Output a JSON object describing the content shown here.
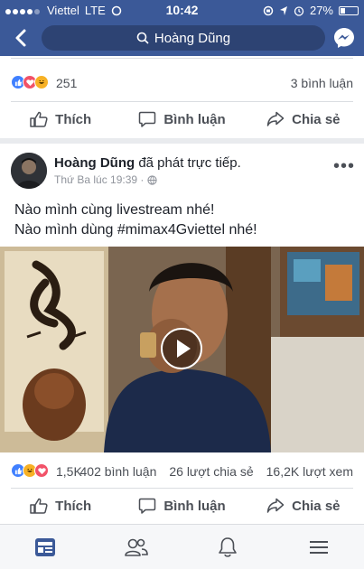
{
  "status_bar": {
    "carrier": "Viettel",
    "network": "LTE",
    "time": "10:42",
    "battery": "27%",
    "battery_level": 0.27
  },
  "nav": {
    "search_text": "Hoàng Dũng"
  },
  "previous_post": {
    "reaction_count": "251",
    "comment_count": "3 bình luận",
    "actions": {
      "like": "Thích",
      "comment": "Bình luận",
      "share": "Chia sẻ"
    }
  },
  "post": {
    "author": "Hoàng Dũng",
    "activity": "đã phát trực tiếp.",
    "timestamp": "Thứ Ba lúc 19:39 ·",
    "text_line1": "Nào mình cùng livestream nhé!",
    "text_line2": "Nào mình dùng #mimax4Gviettel nhé!",
    "reaction_count": "1,5K",
    "comments": "402 bình luận",
    "shares": "26 lượt chia sẻ",
    "views": "16,2K lượt xem",
    "actions": {
      "like": "Thích",
      "comment": "Bình luận",
      "share": "Chia sẻ"
    }
  },
  "colors": {
    "brand": "#3b5998",
    "like": "#4080ff",
    "love": "#f25268",
    "haha": "#f7b125"
  },
  "tab_bar": {
    "tabs": [
      "news-feed-icon",
      "friends-icon",
      "notifications-icon",
      "menu-icon"
    ]
  }
}
